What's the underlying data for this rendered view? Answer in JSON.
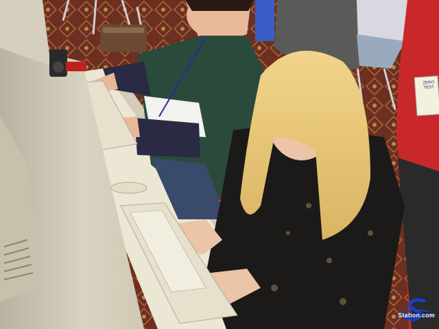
{
  "image": {
    "kind": "photograph",
    "scene": "convention hall keyboard test"
  },
  "badge": {
    "text": "ZERO\nTEST"
  },
  "watermark": {
    "label": "Station.com",
    "logo_icon": "s-swoosh-logo-icon"
  },
  "colors": {
    "carpet": "#6e2f22",
    "carpet_pattern": "#b08040",
    "monitor_beige": "#d8d2c0",
    "desk_top": "#ece6d4",
    "keyboard": "#e6e0cc",
    "hair_blonde": "#e8c878",
    "watermark_blue": "#1a3fc0"
  }
}
